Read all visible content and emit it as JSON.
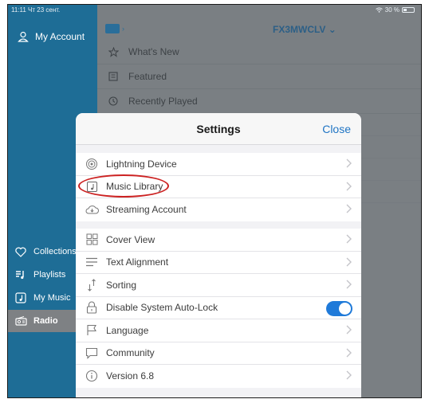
{
  "status_bar": {
    "time_date": "11:11 Чт 23 сент.",
    "battery": "30 %"
  },
  "sidebar": {
    "account_label": "My Account",
    "items": [
      {
        "label": "Collections",
        "icon": "heart-icon"
      },
      {
        "label": "Playlists",
        "icon": "playlist-icon"
      },
      {
        "label": "My Music",
        "icon": "music-note-icon"
      },
      {
        "label": "Radio",
        "icon": "radio-icon",
        "active": true
      }
    ]
  },
  "main": {
    "device_title": "FX3MWCLV ⌄",
    "menu": [
      {
        "label": "What's New",
        "icon": "star-icon"
      },
      {
        "label": "Featured",
        "icon": "featured-icon"
      },
      {
        "label": "Recently Played",
        "icon": "clock-icon"
      }
    ]
  },
  "settings": {
    "title": "Settings",
    "close_label": "Close",
    "group1": [
      {
        "label": "Lightning Device",
        "icon": "lightning-device-icon"
      },
      {
        "label": "Music Library",
        "icon": "music-library-icon"
      },
      {
        "label": "Streaming Account",
        "icon": "streaming-cloud-icon"
      }
    ],
    "group2": [
      {
        "label": "Cover View",
        "icon": "grid-icon"
      },
      {
        "label": "Text Alignment",
        "icon": "text-align-icon"
      },
      {
        "label": "Sorting",
        "icon": "sort-icon"
      },
      {
        "label": "Disable System Auto-Lock",
        "icon": "lock-icon",
        "toggle_on": true
      },
      {
        "label": "Language",
        "icon": "flag-icon"
      },
      {
        "label": "Community",
        "icon": "chat-icon"
      },
      {
        "label": "Version 6.8",
        "icon": "info-icon"
      }
    ]
  },
  "colors": {
    "accent": "#1f74c4",
    "sidebar": "#1e6d96",
    "toggle_on": "#1f7ad9",
    "annotation": "#cc2222"
  }
}
